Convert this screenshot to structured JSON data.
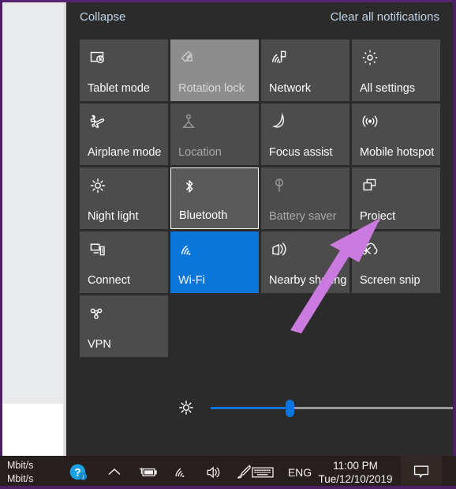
{
  "window": {
    "border_color": "#4b1f63",
    "panel_bg": "#2b2b2b",
    "tile_bg": "#4c4c4c",
    "accent": "#0b76da",
    "link_color": "#c3d4e8"
  },
  "header": {
    "collapse_label": "Collapse",
    "clear_label": "Clear all notifications"
  },
  "quick_actions": {
    "rows": [
      [
        {
          "id": "tablet-mode",
          "label": "Tablet mode",
          "icon": "tablet-mode-icon",
          "state": "off"
        },
        {
          "id": "rotation-lock",
          "label": "Rotation lock",
          "icon": "rotation-lock-icon",
          "state": "disabled-hover"
        },
        {
          "id": "network",
          "label": "Network",
          "icon": "network-icon",
          "state": "off"
        },
        {
          "id": "all-settings",
          "label": "All settings",
          "icon": "gear-icon",
          "state": "off"
        }
      ],
      [
        {
          "id": "airplane-mode",
          "label": "Airplane mode",
          "icon": "airplane-icon",
          "state": "off"
        },
        {
          "id": "location",
          "label": "Location",
          "icon": "location-icon",
          "state": "disabled"
        },
        {
          "id": "focus-assist",
          "label": "Focus assist",
          "icon": "moon-icon",
          "state": "off"
        },
        {
          "id": "mobile-hotspot",
          "label": "Mobile hotspot",
          "icon": "hotspot-icon",
          "state": "off"
        }
      ],
      [
        {
          "id": "night-light",
          "label": "Night light",
          "icon": "sun-icon",
          "state": "off"
        },
        {
          "id": "bluetooth",
          "label": "Bluetooth",
          "icon": "bluetooth-icon",
          "state": "hover"
        },
        {
          "id": "battery-saver",
          "label": "Battery saver",
          "icon": "battery-leaf-icon",
          "state": "disabled"
        },
        {
          "id": "project",
          "label": "Project",
          "icon": "project-icon",
          "state": "off"
        }
      ],
      [
        {
          "id": "connect",
          "label": "Connect",
          "icon": "connect-icon",
          "state": "off"
        },
        {
          "id": "wifi",
          "label": "Wi-Fi",
          "icon": "wifi-icon",
          "state": "on"
        },
        {
          "id": "nearby-sharing",
          "label": "Nearby sharing",
          "icon": "nearby-sharing-icon",
          "state": "off"
        },
        {
          "id": "screen-snip",
          "label": "Screen snip",
          "icon": "snip-icon",
          "state": "off"
        }
      ],
      [
        {
          "id": "vpn",
          "label": "VPN",
          "icon": "vpn-icon",
          "state": "off"
        }
      ]
    ]
  },
  "brightness": {
    "icon": "brightness-icon",
    "value_percent": 32,
    "fill_color": "#0b76da",
    "track_color": "#9a9a9a"
  },
  "annotation": {
    "arrow_color": "#cb7ae0",
    "points_to": "Project"
  },
  "taskbar": {
    "network_speed_up": "Mbit/s",
    "network_speed_down": "Mbit/s",
    "tray_icons": [
      {
        "id": "help",
        "name": "help-question-icon"
      },
      {
        "id": "show-hidden",
        "name": "chevron-up-icon"
      },
      {
        "id": "battery",
        "name": "battery-charging-icon"
      },
      {
        "id": "wifi",
        "name": "wifi-tray-icon"
      },
      {
        "id": "volume",
        "name": "speaker-icon"
      },
      {
        "id": "pen",
        "name": "pen-icon"
      },
      {
        "id": "keyboard",
        "name": "touch-keyboard-icon"
      }
    ],
    "language": "ENG",
    "clock_time": "11:00 PM",
    "clock_date": "Tue/12/10/2019",
    "action_center_icon": "action-center-icon"
  }
}
